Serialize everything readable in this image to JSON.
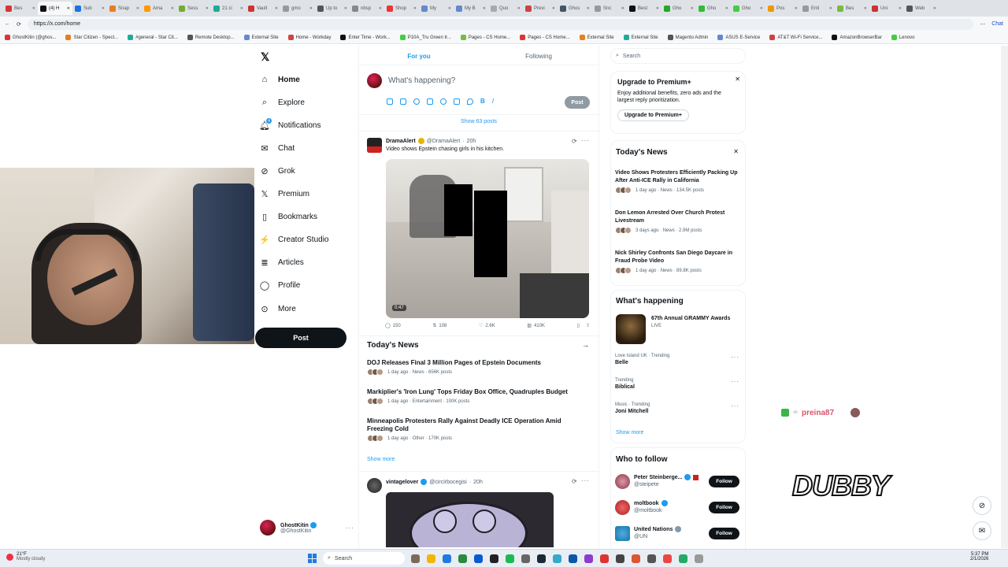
{
  "browser": {
    "tabs": [
      "Bes",
      "(4) H",
      "Sub",
      "Snap",
      "Ama",
      "Sess",
      "21 ci",
      "Vault",
      "gmo",
      "Up to",
      "nbsp",
      "Shop",
      "My",
      "My B",
      "Quo",
      "Previ",
      "Ghos",
      "Snc",
      "Best",
      "Gho",
      "Gho",
      "Gho",
      "Pos",
      "Enti",
      "Bes",
      "Uni",
      "Web"
    ],
    "active_tab_index": 1,
    "url": "https://x.com/home",
    "bookmarks": [
      "GhostKitin (@ghos...",
      "Star Citizen - Spect...",
      "#general - Star Cit...",
      "Remote Desktop...",
      "External Site",
      "Home - Workday",
      "Enter Time - Work...",
      "P10A_Tru Green tr...",
      "Pages - CS Home...",
      "Pages - CS Home...",
      "External Site",
      "External Site",
      "Magento Admin",
      "ASUS E-Service",
      "AT&T Wi-Fi Service...",
      "AmazonBrowserBar",
      "Lenovo"
    ],
    "profile_label": "Chat"
  },
  "nav": {
    "items": [
      {
        "label": "Home",
        "icon": "home-icon",
        "bold": true
      },
      {
        "label": "Explore",
        "icon": "search-icon"
      },
      {
        "label": "Notifications",
        "icon": "bell-icon",
        "badge": "4"
      },
      {
        "label": "Chat",
        "icon": "mail-icon"
      },
      {
        "label": "Grok",
        "icon": "grok-icon"
      },
      {
        "label": "Premium",
        "icon": "x-logo-icon"
      },
      {
        "label": "Bookmarks",
        "icon": "bookmark-icon"
      },
      {
        "label": "Creator Studio",
        "icon": "creator-icon"
      },
      {
        "label": "Articles",
        "icon": "articles-icon"
      },
      {
        "label": "Profile",
        "icon": "person-icon"
      },
      {
        "label": "More",
        "icon": "more-icon"
      }
    ],
    "post_button": "Post",
    "account": {
      "name": "GhostKitin",
      "handle": "@GhostKitin"
    }
  },
  "feed": {
    "tabs": [
      "For you",
      "Following"
    ],
    "composer_placeholder": "What's happening?",
    "composer_post": "Post",
    "show_posts": "Show 63 posts",
    "post1": {
      "name": "DramaAlert",
      "handle": "@DramaAlert",
      "time": "20h",
      "text": "Video shows Epstein chasing girls in his kitchen.",
      "duration": "0:47",
      "replies": "150",
      "reposts": "108",
      "likes": "2.6K",
      "views": "410K"
    },
    "news_title": "Today's News",
    "news": [
      {
        "headline": "DOJ Releases Final 3 Million Pages of Epstein Documents",
        "meta": "1 day ago · News · 656K posts"
      },
      {
        "headline": "Markiplier's 'Iron Lung' Tops Friday Box Office, Quadruples Budget",
        "meta": "1 day ago · Entertainment · 100K posts"
      },
      {
        "headline": "Minneapolis Protesters Rally Against Deadly ICE Operation Amid Freezing Cold",
        "meta": "1 day ago · Other · 170K posts"
      }
    ],
    "show_more": "Show more",
    "post2": {
      "name": "vintagelover",
      "handle": "@circirbocegisi",
      "time": "20h"
    }
  },
  "right": {
    "search_placeholder": "Search",
    "premium": {
      "title": "Upgrade to Premium+",
      "body": "Enjoy additional benefits, zero ads and the largest reply prioritization.",
      "button": "Upgrade to Premium+"
    },
    "news_title": "Today's News",
    "news": [
      {
        "headline": "Video Shows Protesters Efficiently Packing Up After Anti-ICE Rally in California",
        "meta": "1 day ago · News · 134.5K posts"
      },
      {
        "headline": "Don Lemon Arrested Over Church Protest Livestream",
        "meta": "3 days ago · News · 2.9M posts"
      },
      {
        "headline": "Nick Shirley Confronts San Diego Daycare in Fraud Probe Video",
        "meta": "1 day ago · News · 89.8K posts"
      }
    ],
    "happening_title": "What's happening",
    "event": {
      "title": "67th Annual GRAMMY Awards",
      "status": "LIVE"
    },
    "trends": [
      {
        "context": "Love Island UK · Trending",
        "name": "Belle"
      },
      {
        "context": "Trending",
        "name": "Biblical"
      },
      {
        "context": "Music · Trending",
        "name": "Joni Mitchell"
      }
    ],
    "show_more": "Show more",
    "follow_title": "Who to follow",
    "follow": [
      {
        "name": "Peter Steinberge...",
        "handle": "@steipete",
        "button": "Follow"
      },
      {
        "name": "moltbook",
        "handle": "@moltbook",
        "button": "Follow"
      },
      {
        "name": "United Nations",
        "handle": "@UN",
        "button": "Follow"
      }
    ]
  },
  "overlay": {
    "chat_user": "preina87",
    "brand": "DUBBY"
  },
  "taskbar": {
    "weather_temp": "21°F",
    "weather_desc": "Mostly cloudy",
    "search": "Search",
    "time": "5:37 PM",
    "date": "2/1/2026"
  },
  "colors": {
    "accent": "#1d9bf0",
    "dark": "#0f1419",
    "muted": "#536471"
  }
}
